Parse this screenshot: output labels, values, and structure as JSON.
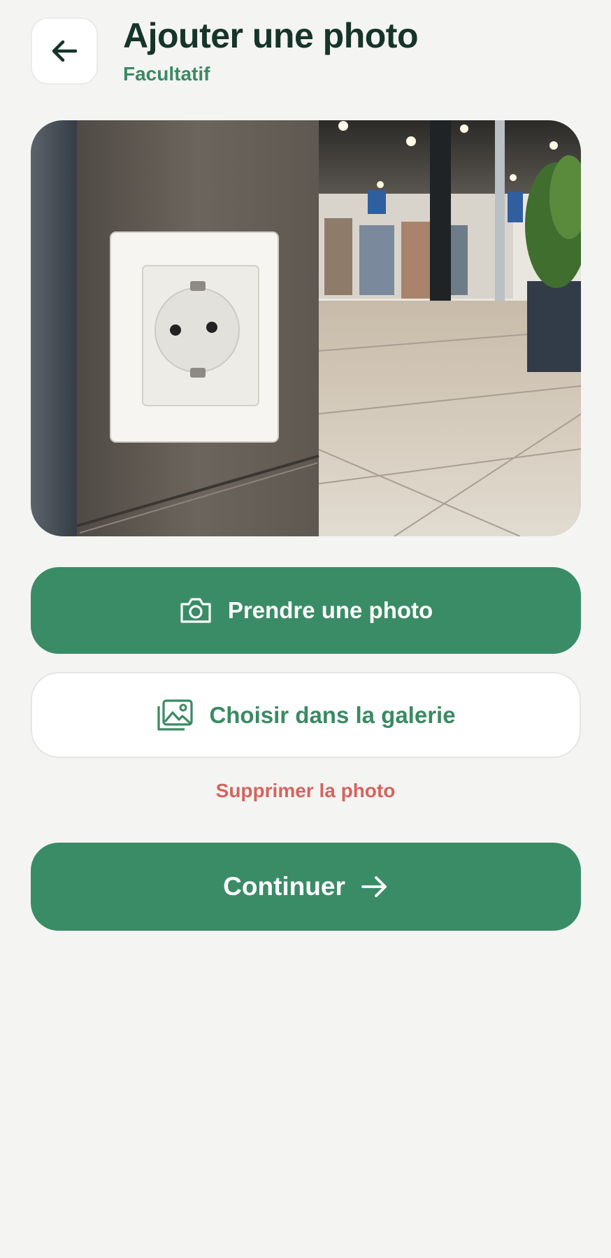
{
  "header": {
    "title": "Ajouter une photo",
    "subtitle": "Facultatif",
    "back_icon": "arrow-left-icon"
  },
  "photo": {
    "description_icon": "photo-preview"
  },
  "actions": {
    "take_photo_label": "Prendre une photo",
    "take_photo_icon": "camera-icon",
    "gallery_label": "Choisir dans la galerie",
    "gallery_icon": "gallery-icon",
    "delete_label": "Supprimer la photo",
    "continue_label": "Continuer",
    "continue_icon": "arrow-right-icon"
  },
  "colors": {
    "primary": "#3a8c66",
    "title": "#16342a",
    "danger": "#d4645e",
    "background": "#f4f5f3"
  }
}
